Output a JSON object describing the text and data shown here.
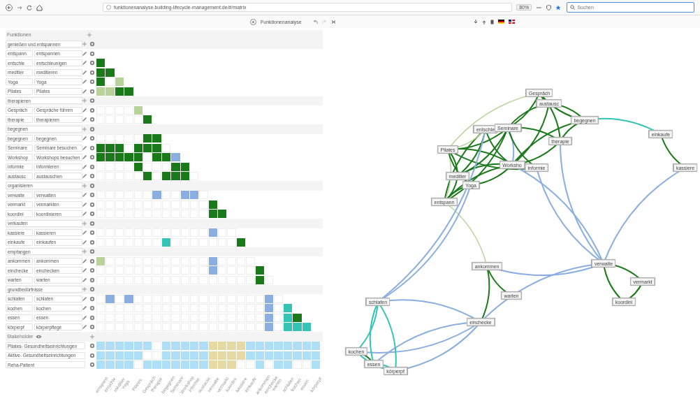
{
  "browser": {
    "url": "funktionenanalyse.building-lifecycle-management.de/#/matrix",
    "zoom": "80%",
    "search_placeholder": "Suchen"
  },
  "app_toolbar": {
    "title": "Funktionenanalyse"
  },
  "functions_panel": {
    "header": "Funktionen",
    "groups": [
      {
        "name": "genießen und entspannen",
        "functions": [
          {
            "short": "entspann",
            "name": "entspannen"
          },
          {
            "short": "entschle",
            "name": "entschleunigen",
            "cells": [
              {
                "color": "#1a7a1a"
              }
            ]
          },
          {
            "short": "meditier",
            "name": "meditieren",
            "cells": [
              {
                "color": "#1a7a1a"
              },
              {
                "color": "#1a7a1a"
              }
            ]
          },
          {
            "short": "Yoga",
            "name": "Yoga",
            "cells": [
              {
                "color": "#1a7a1a"
              },
              {
                "color": "#ffffff"
              },
              {
                "color": "#b8d39a"
              }
            ]
          },
          {
            "short": "Pilates",
            "name": "Pilates",
            "cells": [
              {
                "color": "#b8d39a"
              },
              {
                "color": "#b8d39a"
              },
              {
                "color": "#1a7a1a"
              },
              {
                "color": "#1a7a1a"
              }
            ]
          }
        ]
      },
      {
        "name": "therapieren",
        "functions": [
          {
            "short": "Gespräch",
            "name": "Gespräche führen",
            "cells": [
              {
                "color": "#ffffff"
              },
              {
                "color": "#ffffff"
              },
              {
                "color": "#ffffff"
              },
              {
                "color": "#ffffff"
              },
              {
                "color": "#b8d39a"
              }
            ]
          },
          {
            "short": "therapie",
            "name": "therapieren",
            "cells": [
              {
                "color": "#ffffff"
              },
              {
                "color": "#ffffff"
              },
              {
                "color": "#ffffff"
              },
              {
                "color": "#ffffff"
              },
              {
                "color": "#ffffff"
              },
              {
                "color": "#1a7a1a"
              }
            ]
          }
        ]
      },
      {
        "name": "begegnen",
        "functions": [
          {
            "short": "begegnen",
            "name": "begegnen",
            "cells": [
              {
                "color": "#ffffff"
              },
              {
                "color": "#ffffff"
              },
              {
                "color": "#ffffff"
              },
              {
                "color": "#ffffff"
              },
              {
                "color": "#ffffff"
              },
              {
                "color": "#1a7a1a"
              },
              {
                "color": "#1a7a1a"
              }
            ]
          },
          {
            "short": "Seminare",
            "name": "Seminare besuchen",
            "cells": [
              {
                "color": "#1a7a1a"
              },
              {
                "color": "#1a7a1a"
              },
              {
                "color": "#1a7a1a"
              },
              {
                "color": "#ffffff"
              },
              {
                "color": "#1a7a1a"
              },
              {
                "color": "#1a7a1a"
              },
              {
                "color": "#1a7a1a"
              },
              {
                "color": "#ffffff"
              }
            ]
          },
          {
            "short": "Workshop",
            "name": "Workshops besuchen",
            "cells": [
              {
                "color": "#1a7a1a"
              },
              {
                "color": "#1a7a1a"
              },
              {
                "color": "#1a7a1a"
              },
              {
                "color": "#1a7a1a"
              },
              {
                "color": "#1a7a1a"
              },
              {
                "color": "#ffffff"
              },
              {
                "color": "#1a7a1a"
              },
              {
                "color": "#1a7a1a"
              },
              {
                "color": "#8aaee0"
              }
            ]
          },
          {
            "short": "informie",
            "name": "informieren",
            "cells": [
              {
                "color": "#ffffff"
              },
              {
                "color": "#ffffff"
              },
              {
                "color": "#ffffff"
              },
              {
                "color": "#ffffff"
              },
              {
                "color": "#1a7a1a"
              },
              {
                "color": "#ffffff"
              },
              {
                "color": "#ffffff"
              },
              {
                "color": "#ffffff"
              },
              {
                "color": "#1a7a1a"
              },
              {
                "color": "#1a7a1a"
              }
            ]
          },
          {
            "short": "austausc",
            "name": "austauschen",
            "cells": [
              {
                "color": "#ffffff"
              },
              {
                "color": "#ffffff"
              },
              {
                "color": "#ffffff"
              },
              {
                "color": "#ffffff"
              },
              {
                "color": "#ffffff"
              },
              {
                "color": "#1a7a1a"
              },
              {
                "color": "#ffffff"
              },
              {
                "color": "#1a7a1a"
              },
              {
                "color": "#1a7a1a"
              },
              {
                "color": "#1a7a1a"
              },
              {
                "color": "#ffffff"
              }
            ]
          }
        ]
      },
      {
        "name": "organisieren",
        "functions": [
          {
            "short": "verwalte",
            "name": "verwalten",
            "cells": [
              {
                "color": "#ffffff"
              },
              {
                "color": "#ffffff"
              },
              {
                "color": "#ffffff"
              },
              {
                "color": "#ffffff"
              },
              {
                "color": "#ffffff"
              },
              {
                "color": "#ffffff"
              },
              {
                "color": "#8aaee0"
              },
              {
                "color": "#ffffff"
              },
              {
                "color": "#ffffff"
              },
              {
                "color": "#8aaee0"
              },
              {
                "color": "#8aaee0"
              },
              {
                "color": "#ffffff"
              }
            ]
          },
          {
            "short": "vermarkt",
            "name": "vermarkten",
            "cells": [
              {
                "color": "#ffffff"
              },
              {
                "color": "#ffffff"
              },
              {
                "color": "#ffffff"
              },
              {
                "color": "#ffffff"
              },
              {
                "color": "#ffffff"
              },
              {
                "color": "#ffffff"
              },
              {
                "color": "#ffffff"
              },
              {
                "color": "#ffffff"
              },
              {
                "color": "#ffffff"
              },
              {
                "color": "#ffffff"
              },
              {
                "color": "#ffffff"
              },
              {
                "color": "#ffffff"
              },
              {
                "color": "#1a7a1a"
              }
            ]
          },
          {
            "short": "koordini",
            "name": "koordinieren",
            "cells": [
              {
                "color": "#ffffff"
              },
              {
                "color": "#ffffff"
              },
              {
                "color": "#ffffff"
              },
              {
                "color": "#ffffff"
              },
              {
                "color": "#ffffff"
              },
              {
                "color": "#ffffff"
              },
              {
                "color": "#ffffff"
              },
              {
                "color": "#ffffff"
              },
              {
                "color": "#ffffff"
              },
              {
                "color": "#ffffff"
              },
              {
                "color": "#ffffff"
              },
              {
                "color": "#ffffff"
              },
              {
                "color": "#1a7a1a"
              },
              {
                "color": "#1a7a1a"
              }
            ]
          }
        ]
      },
      {
        "name": "verkaufen",
        "functions": [
          {
            "short": "kassiere",
            "name": "kassieren",
            "cells": [
              {
                "color": "#ffffff"
              },
              {
                "color": "#ffffff"
              },
              {
                "color": "#ffffff"
              },
              {
                "color": "#ffffff"
              },
              {
                "color": "#ffffff"
              },
              {
                "color": "#ffffff"
              },
              {
                "color": "#ffffff"
              },
              {
                "color": "#ffffff"
              },
              {
                "color": "#ffffff"
              },
              {
                "color": "#ffffff"
              },
              {
                "color": "#ffffff"
              },
              {
                "color": "#ffffff"
              },
              {
                "color": "#8aaee0"
              },
              {
                "color": "#ffffff"
              },
              {
                "color": "#ffffff"
              }
            ]
          },
          {
            "short": "einkaufe",
            "name": "einkaufen",
            "cells": [
              {
                "color": "#ffffff"
              },
              {
                "color": "#ffffff"
              },
              {
                "color": "#ffffff"
              },
              {
                "color": "#ffffff"
              },
              {
                "color": "#ffffff"
              },
              {
                "color": "#ffffff"
              },
              {
                "color": "#ffffff"
              },
              {
                "color": "#33c4b5"
              },
              {
                "color": "#ffffff"
              },
              {
                "color": "#ffffff"
              },
              {
                "color": "#ffffff"
              },
              {
                "color": "#ffffff"
              },
              {
                "color": "#ffffff"
              },
              {
                "color": "#ffffff"
              },
              {
                "color": "#ffffff"
              },
              {
                "color": "#1a7a1a"
              }
            ]
          }
        ]
      },
      {
        "name": "empfangen",
        "functions": [
          {
            "short": "ankommen",
            "name": "ankommen",
            "cells": [
              {
                "color": "#b8d39a"
              },
              {
                "color": "#ffffff"
              },
              {
                "color": "#ffffff"
              },
              {
                "color": "#ffffff"
              },
              {
                "color": "#ffffff"
              },
              {
                "color": "#ffffff"
              },
              {
                "color": "#ffffff"
              },
              {
                "color": "#ffffff"
              },
              {
                "color": "#ffffff"
              },
              {
                "color": "#ffffff"
              },
              {
                "color": "#ffffff"
              },
              {
                "color": "#ffffff"
              },
              {
                "color": "#8aaee0"
              },
              {
                "color": "#ffffff"
              },
              {
                "color": "#ffffff"
              },
              {
                "color": "#ffffff"
              },
              {
                "color": "#ffffff"
              }
            ]
          },
          {
            "short": "einchecke",
            "name": "einchecken",
            "cells": [
              {
                "color": "#ffffff"
              },
              {
                "color": "#ffffff"
              },
              {
                "color": "#ffffff"
              },
              {
                "color": "#ffffff"
              },
              {
                "color": "#ffffff"
              },
              {
                "color": "#ffffff"
              },
              {
                "color": "#ffffff"
              },
              {
                "color": "#ffffff"
              },
              {
                "color": "#ffffff"
              },
              {
                "color": "#ffffff"
              },
              {
                "color": "#ffffff"
              },
              {
                "color": "#ffffff"
              },
              {
                "color": "#8aaee0"
              },
              {
                "color": "#ffffff"
              },
              {
                "color": "#ffffff"
              },
              {
                "color": "#ffffff"
              },
              {
                "color": "#ffffff"
              },
              {
                "color": "#1a7a1a"
              }
            ]
          },
          {
            "short": "warten",
            "name": "warten",
            "cells": [
              {
                "color": "#ffffff"
              },
              {
                "color": "#ffffff"
              },
              {
                "color": "#ffffff"
              },
              {
                "color": "#ffffff"
              },
              {
                "color": "#ffffff"
              },
              {
                "color": "#ffffff"
              },
              {
                "color": "#ffffff"
              },
              {
                "color": "#ffffff"
              },
              {
                "color": "#ffffff"
              },
              {
                "color": "#ffffff"
              },
              {
                "color": "#ffffff"
              },
              {
                "color": "#ffffff"
              },
              {
                "color": "#ffffff"
              },
              {
                "color": "#ffffff"
              },
              {
                "color": "#ffffff"
              },
              {
                "color": "#ffffff"
              },
              {
                "color": "#ffffff"
              },
              {
                "color": "#1a7a1a"
              },
              {
                "color": "#ffffff"
              }
            ]
          }
        ]
      },
      {
        "name": "grundbedürfnisse",
        "functions": [
          {
            "short": "schlafen",
            "name": "schlafen",
            "cells": [
              {
                "color": "#ffffff"
              },
              {
                "color": "#8aaee0"
              },
              {
                "color": "#ffffff"
              },
              {
                "color": "#8aaee0"
              },
              {
                "color": "#ffffff"
              },
              {
                "color": "#ffffff"
              },
              {
                "color": "#ffffff"
              },
              {
                "color": "#ffffff"
              },
              {
                "color": "#ffffff"
              },
              {
                "color": "#ffffff"
              },
              {
                "color": "#ffffff"
              },
              {
                "color": "#ffffff"
              },
              {
                "color": "#ffffff"
              },
              {
                "color": "#ffffff"
              },
              {
                "color": "#ffffff"
              },
              {
                "color": "#ffffff"
              },
              {
                "color": "#ffffff"
              },
              {
                "color": "#ffffff"
              },
              {
                "color": "#8aaee0"
              },
              {
                "color": "#ffffff"
              }
            ]
          },
          {
            "short": "kochen",
            "name": "kochen",
            "cells": [
              {
                "color": "#ffffff"
              },
              {
                "color": "#ffffff"
              },
              {
                "color": "#ffffff"
              },
              {
                "color": "#ffffff"
              },
              {
                "color": "#ffffff"
              },
              {
                "color": "#ffffff"
              },
              {
                "color": "#ffffff"
              },
              {
                "color": "#ffffff"
              },
              {
                "color": "#ffffff"
              },
              {
                "color": "#ffffff"
              },
              {
                "color": "#ffffff"
              },
              {
                "color": "#ffffff"
              },
              {
                "color": "#ffffff"
              },
              {
                "color": "#ffffff"
              },
              {
                "color": "#ffffff"
              },
              {
                "color": "#ffffff"
              },
              {
                "color": "#ffffff"
              },
              {
                "color": "#ffffff"
              },
              {
                "color": "#8aaee0"
              },
              {
                "color": "#ffffff"
              },
              {
                "color": "#33c4b5"
              }
            ]
          },
          {
            "short": "essen",
            "name": "essen",
            "cells": [
              {
                "color": "#ffffff"
              },
              {
                "color": "#ffffff"
              },
              {
                "color": "#ffffff"
              },
              {
                "color": "#ffffff"
              },
              {
                "color": "#ffffff"
              },
              {
                "color": "#ffffff"
              },
              {
                "color": "#ffffff"
              },
              {
                "color": "#ffffff"
              },
              {
                "color": "#ffffff"
              },
              {
                "color": "#ffffff"
              },
              {
                "color": "#ffffff"
              },
              {
                "color": "#ffffff"
              },
              {
                "color": "#ffffff"
              },
              {
                "color": "#ffffff"
              },
              {
                "color": "#ffffff"
              },
              {
                "color": "#ffffff"
              },
              {
                "color": "#ffffff"
              },
              {
                "color": "#ffffff"
              },
              {
                "color": "#8aaee0"
              },
              {
                "color": "#ffffff"
              },
              {
                "color": "#33c4b5"
              },
              {
                "color": "#1a7a1a"
              }
            ]
          },
          {
            "short": "körperpf",
            "name": "körperpflege",
            "cells": [
              {
                "color": "#ffffff"
              },
              {
                "color": "#ffffff"
              },
              {
                "color": "#ffffff"
              },
              {
                "color": "#ffffff"
              },
              {
                "color": "#ffffff"
              },
              {
                "color": "#ffffff"
              },
              {
                "color": "#ffffff"
              },
              {
                "color": "#ffffff"
              },
              {
                "color": "#ffffff"
              },
              {
                "color": "#ffffff"
              },
              {
                "color": "#ffffff"
              },
              {
                "color": "#ffffff"
              },
              {
                "color": "#ffffff"
              },
              {
                "color": "#ffffff"
              },
              {
                "color": "#ffffff"
              },
              {
                "color": "#ffffff"
              },
              {
                "color": "#ffffff"
              },
              {
                "color": "#ffffff"
              },
              {
                "color": "#8aaee0"
              },
              {
                "color": "#ffffff"
              },
              {
                "color": "#33c4b5"
              },
              {
                "color": "#33c4b5"
              },
              {
                "color": "#33c4b5"
              }
            ]
          }
        ]
      }
    ]
  },
  "stakeholders": {
    "header": "Stakeholder",
    "rows": [
      {
        "name": "Pilates- Gesundheitseinrichtungen",
        "cells": [
          {
            "color": "#aedff7"
          },
          {
            "color": "#aedff7"
          },
          {
            "color": "#aedff7"
          },
          {
            "color": "#aedff7"
          },
          {
            "color": "#aedff7"
          },
          {
            "color": "#aedff7"
          },
          {
            "color": "#ffffff"
          },
          {
            "color": "#aedff7"
          },
          {
            "color": "#aedff7"
          },
          {
            "color": "#aedff7"
          },
          {
            "color": "#aedff7"
          },
          {
            "color": "#aedff7"
          },
          {
            "color": "#e6d9a3"
          },
          {
            "color": "#e6d9a3"
          },
          {
            "color": "#e6d9a3"
          },
          {
            "color": "#e6d9a3"
          },
          {
            "color": "#aedff7"
          },
          {
            "color": "#aedff7"
          },
          {
            "color": "#aedff7"
          },
          {
            "color": "#aedff7"
          },
          {
            "color": "#aedff7"
          },
          {
            "color": "#aedff7"
          },
          {
            "color": "#aedff7"
          },
          {
            "color": "#aedff7"
          }
        ]
      },
      {
        "name": "Aktive- Gesundheitseinrichtungen",
        "cells": [
          {
            "color": "#aedff7"
          },
          {
            "color": "#aedff7"
          },
          {
            "color": "#aedff7"
          },
          {
            "color": "#aedff7"
          },
          {
            "color": "#aedff7"
          },
          {
            "color": "#ffffff"
          },
          {
            "color": "#ffffff"
          },
          {
            "color": "#aedff7"
          },
          {
            "color": "#aedff7"
          },
          {
            "color": "#aedff7"
          },
          {
            "color": "#aedff7"
          },
          {
            "color": "#aedff7"
          },
          {
            "color": "#e6d9a3"
          },
          {
            "color": "#e6d9a3"
          },
          {
            "color": "#e6d9a3"
          },
          {
            "color": "#e6d9a3"
          },
          {
            "color": "#aedff7"
          },
          {
            "color": "#aedff7"
          },
          {
            "color": "#aedff7"
          },
          {
            "color": "#aedff7"
          },
          {
            "color": "#aedff7"
          },
          {
            "color": "#aedff7"
          },
          {
            "color": "#aedff7"
          },
          {
            "color": "#aedff7"
          }
        ]
      },
      {
        "name": "Reha-Patient",
        "cells": [
          {
            "color": "#aedff7"
          },
          {
            "color": "#aedff7"
          },
          {
            "color": "#aedff7"
          },
          {
            "color": "#aedff7"
          },
          {
            "color": "#ffffff"
          },
          {
            "color": "#aedff7"
          },
          {
            "color": "#aedff7"
          },
          {
            "color": "#aedff7"
          },
          {
            "color": "#aedff7"
          },
          {
            "color": "#aedff7"
          },
          {
            "color": "#aedff7"
          },
          {
            "color": "#aedff7"
          },
          {
            "color": "#e6d9a3"
          },
          {
            "color": "#e6d9a3"
          },
          {
            "color": "#e6d9a3"
          },
          {
            "color": "#ffffff"
          },
          {
            "color": "#ffffff"
          },
          {
            "color": "#aedff7"
          },
          {
            "color": "#ffffff"
          },
          {
            "color": "#aedff7"
          },
          {
            "color": "#aedff7"
          },
          {
            "color": "#ffffff"
          },
          {
            "color": "#ffffff"
          },
          {
            "color": "#aedff7"
          }
        ]
      }
    ]
  },
  "matrix_column_labels": [
    "entspann",
    "entschle",
    "meditier",
    "Yoga",
    "Pilates",
    "Gespräch",
    "therapie",
    "begegnen",
    "Seminare",
    "Workshop",
    "informie",
    "austausc",
    "verwalte",
    "vermarkt",
    "koordini",
    "kassiere",
    "einkaufe",
    "ankommen",
    "einchecke",
    "warten",
    "schlafen",
    "kochen",
    "essen",
    "körperpf"
  ],
  "graph": {
    "nodes": [
      "entspann",
      "entschle",
      "meditier",
      "Yoga",
      "Pilates",
      "Gespräch",
      "therapie",
      "begegnen",
      "Seminare",
      "Worksho",
      "informie",
      "austausc",
      "verwalte",
      "vermarkt",
      "koordini",
      "kassiere",
      "einkaufe",
      "ankommen",
      "einchecke",
      "warten",
      "schlafen",
      "kochen",
      "essen",
      "körperpf"
    ]
  }
}
